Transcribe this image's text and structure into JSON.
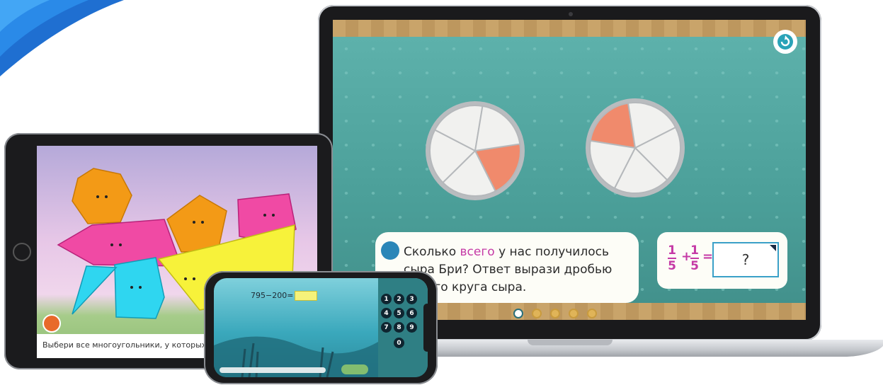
{
  "laptop": {
    "question_parts": [
      "Сколько ",
      "всего",
      " у нас получилось",
      "сыра Бри? Ответ вырази дробью",
      "целого круга сыра."
    ],
    "equation": {
      "frac1_num": "1",
      "frac1_den": "5",
      "op": "+",
      "frac2_num": "1",
      "frac2_den": "5",
      "equals": "=",
      "answer_placeholder": "?"
    },
    "progress_steps": 5,
    "progress_current": 1,
    "pies": [
      {
        "slices": 5,
        "highlighted": 1
      },
      {
        "slices": 5,
        "highlighted": 1
      }
    ]
  },
  "tablet": {
    "caption": "Выбери все многоугольники, у которых ч"
  },
  "phone": {
    "equation": "795−200=",
    "keys": [
      "1",
      "2",
      "3",
      "4",
      "5",
      "6",
      "7",
      "8",
      "9",
      "0"
    ]
  },
  "colors": {
    "accent": "#c53aa6",
    "teal": "#4b9f99",
    "brand_blue": "#1565c0"
  }
}
